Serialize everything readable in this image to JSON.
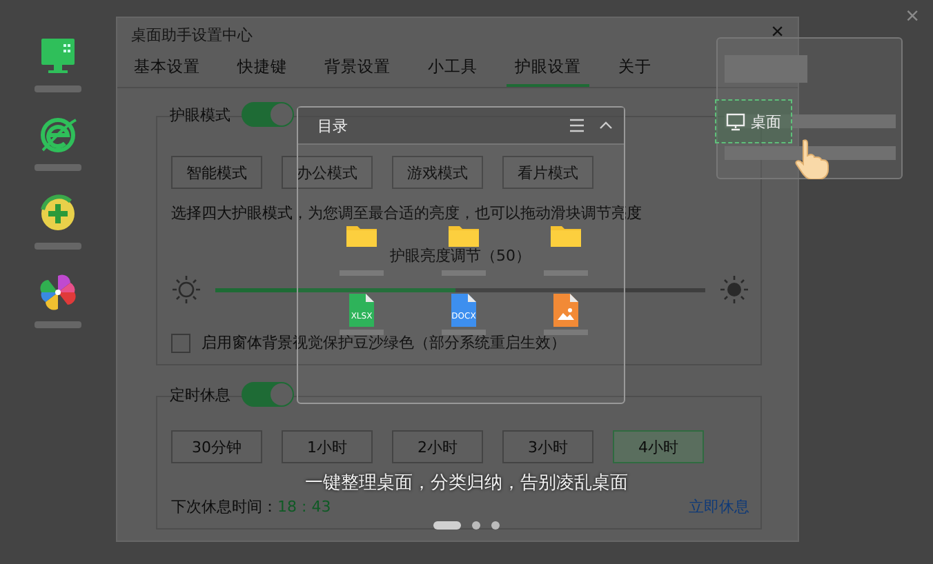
{
  "close": "×",
  "dialog": {
    "title": "桌面助手设置中心",
    "close": "×",
    "tabs": [
      {
        "label": "基本设置",
        "selected": false
      },
      {
        "label": "快捷键",
        "selected": false
      },
      {
        "label": "背景设置",
        "selected": false
      },
      {
        "label": "小工具",
        "selected": false
      },
      {
        "label": "护眼设置",
        "selected": true
      },
      {
        "label": "关于",
        "selected": false
      }
    ],
    "eye_mode": {
      "label": "护眼模式",
      "on": true
    },
    "modes": [
      "智能模式",
      "办公模式",
      "游戏模式",
      "看片模式"
    ],
    "description": "选择四大护眼模式，为您调至最合适的亮度，也可以拖动滑块调节亮度",
    "brightness": {
      "label": "护眼亮度调节（50）",
      "level": 0.49
    },
    "bean_green": {
      "label": "启用窗体背景视觉保护豆沙绿色（部分系统重启生效）",
      "checked": false
    },
    "rest": {
      "label": "定时休息",
      "on": true,
      "options": [
        {
          "label": "30分钟",
          "selected": false
        },
        {
          "label": "1小时",
          "selected": false
        },
        {
          "label": "2小时",
          "selected": false
        },
        {
          "label": "3小时",
          "selected": false
        },
        {
          "label": "4小时",
          "selected": true
        }
      ],
      "next_label": "下次休息时间：",
      "next_time": "18 : 43",
      "rest_now": "立即休息"
    }
  },
  "guide": {
    "panel_title": "目录",
    "items": [
      {
        "kind": "folder"
      },
      {
        "kind": "folder"
      },
      {
        "kind": "folder"
      },
      {
        "kind": "xlsx",
        "badge": "XLSX"
      },
      {
        "kind": "docx",
        "badge": "DOCX"
      },
      {
        "kind": "image"
      }
    ],
    "desktop_chip": "桌面",
    "caption": "一键整理桌面，分类归纳，告别凌乱桌面",
    "pages": [
      {
        "selected": true
      },
      {
        "selected": false
      },
      {
        "selected": false
      }
    ]
  }
}
